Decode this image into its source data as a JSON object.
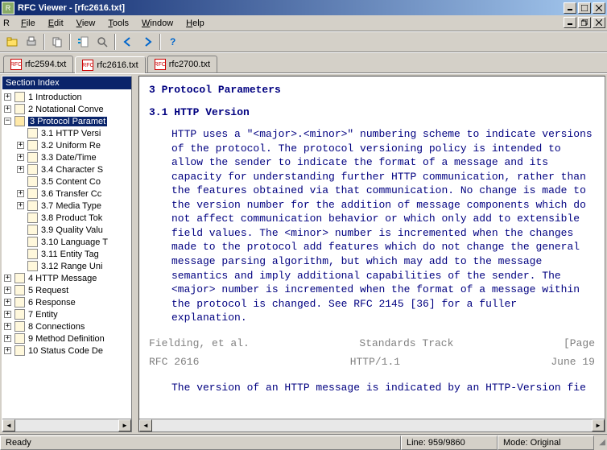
{
  "title": "RFC Viewer - [rfc2616.txt]",
  "menus": {
    "file": "File",
    "edit": "Edit",
    "view": "View",
    "tools": "Tools",
    "window": "Window",
    "help": "Help"
  },
  "tabs": [
    {
      "label": "rfc2594.txt",
      "active": false
    },
    {
      "label": "rfc2616.txt",
      "active": true
    },
    {
      "label": "rfc2700.txt",
      "active": false
    }
  ],
  "sidebar": {
    "title": "Section Index",
    "nodes": [
      {
        "label": "1 Introduction",
        "expandable": true,
        "depth": 0
      },
      {
        "label": "2 Notational Conve",
        "expandable": true,
        "depth": 0
      },
      {
        "label": "3 Protocol Paramet",
        "expandable": true,
        "expanded": true,
        "selected": true,
        "depth": 0,
        "children": [
          {
            "label": "3.1 HTTP Versi",
            "depth": 1
          },
          {
            "label": "3.2 Uniform Re",
            "expandable": true,
            "depth": 1
          },
          {
            "label": "3.3 Date/Time",
            "expandable": true,
            "depth": 1
          },
          {
            "label": "3.4 Character S",
            "expandable": true,
            "depth": 1
          },
          {
            "label": "3.5 Content Co",
            "depth": 1
          },
          {
            "label": "3.6 Transfer Cc",
            "expandable": true,
            "depth": 1
          },
          {
            "label": "3.7 Media Type",
            "expandable": true,
            "depth": 1
          },
          {
            "label": "3.8 Product Tok",
            "depth": 1
          },
          {
            "label": "3.9 Quality Valu",
            "depth": 1
          },
          {
            "label": "3.10 Language T",
            "depth": 1
          },
          {
            "label": "3.11 Entity Tag",
            "depth": 1
          },
          {
            "label": "3.12 Range Uni",
            "depth": 1
          }
        ]
      },
      {
        "label": "4 HTTP Message",
        "expandable": true,
        "depth": 0
      },
      {
        "label": "5 Request",
        "expandable": true,
        "depth": 0
      },
      {
        "label": "6 Response",
        "expandable": true,
        "depth": 0
      },
      {
        "label": "7 Entity",
        "expandable": true,
        "depth": 0
      },
      {
        "label": "8 Connections",
        "expandable": true,
        "depth": 0
      },
      {
        "label": "9 Method Definition",
        "expandable": true,
        "depth": 0
      },
      {
        "label": "10 Status Code De",
        "expandable": true,
        "depth": 0
      }
    ]
  },
  "doc": {
    "h1": "3 Protocol Parameters",
    "h2": "3.1 HTTP Version",
    "p1": "HTTP uses a \"<major>.<minor>\" numbering scheme to indicate versions of the protocol. The protocol versioning policy is intended to allow the sender to indicate the format of a message and its capacity for understanding further HTTP communication, rather than the features obtained via that communication. No change is made to the version number for the addition of message components which do not affect communication behavior or which only add to extensible field values. The <minor> number is incremented when the changes made to the protocol add features which do not change the general message parsing algorithm, but which may add to the message semantics and imply additional capabilities of the sender. The <major> number is incremented when the format of a message within the protocol is changed. See RFC 2145 [36] for a fuller explanation.",
    "footer1": {
      "left": "Fielding, et al.",
      "mid": "Standards Track",
      "right": "[Page"
    },
    "footer2": {
      "left": "RFC 2616",
      "mid": "HTTP/1.1",
      "right": "June 19"
    },
    "p2": "The version of an HTTP message is indicated by an HTTP-Version fie"
  },
  "status": {
    "ready": "Ready",
    "line": "Line: 959/9860",
    "mode": "Mode: Original"
  }
}
